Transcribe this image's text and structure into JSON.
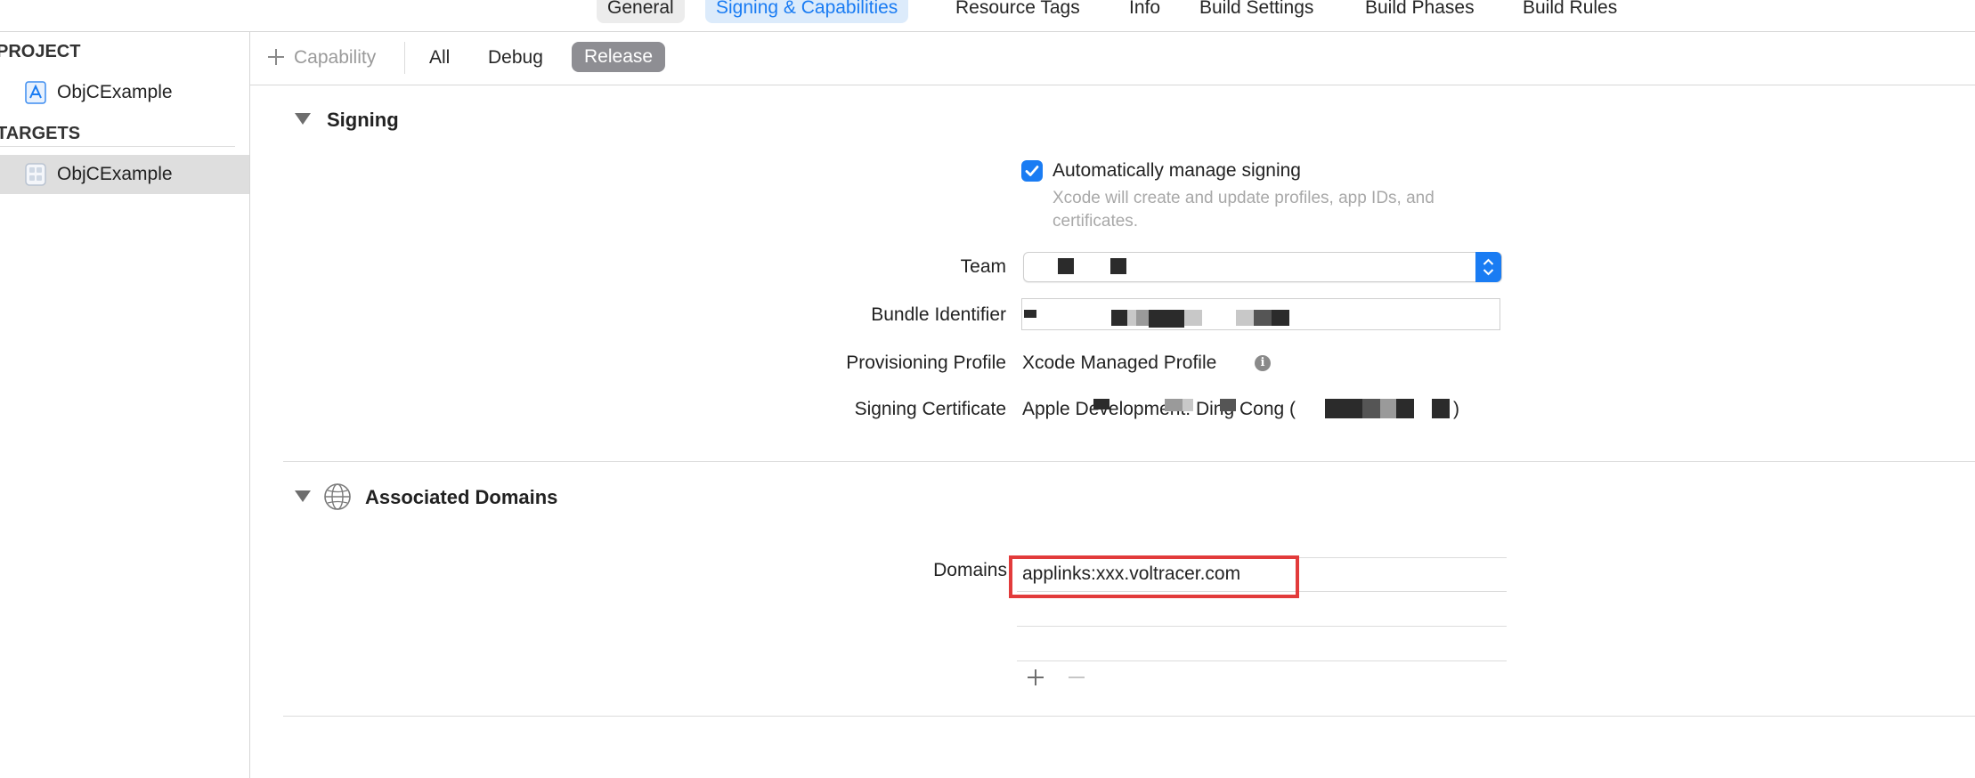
{
  "tabs": [
    {
      "label": "General"
    },
    {
      "label": "Signing & Capabilities"
    },
    {
      "label": "Resource Tags"
    },
    {
      "label": "Info"
    },
    {
      "label": "Build Settings"
    },
    {
      "label": "Build Phases"
    },
    {
      "label": "Build Rules"
    }
  ],
  "sidebar": {
    "project_header": "PROJECT",
    "project_item": "ObjCExample",
    "targets_header": "TARGETS",
    "target_item": "ObjCExample"
  },
  "filterbar": {
    "add_capability": "Capability",
    "all": "All",
    "debug": "Debug",
    "release": "Release"
  },
  "signing": {
    "title": "Signing",
    "auto_manage_label": "Automatically manage signing",
    "auto_manage_checked": true,
    "auto_manage_hint": "Xcode will create and update profiles, app IDs, and certificates.",
    "team_label": "Team",
    "bundle_id_label": "Bundle Identifier",
    "profile_label": "Provisioning Profile",
    "profile_value": "Xcode Managed Profile",
    "certificate_label": "Signing Certificate",
    "certificate_value": "Apple Development: Ding Cong (",
    "certificate_suffix": ")"
  },
  "associated_domains": {
    "title": "Associated Domains",
    "domains_label": "Domains",
    "domains": [
      "applinks:xxx.voltracer.com"
    ]
  },
  "colors": {
    "accent": "#1a7cf3",
    "highlight_border": "#e23b3b",
    "release_pill": "#8e8e93"
  },
  "icons": [
    "plus-icon",
    "disclosure-triangle-icon",
    "globe-icon",
    "info-icon",
    "checkmark-icon",
    "popup-arrows-icon",
    "minus-icon",
    "project-icon",
    "target-icon"
  ]
}
